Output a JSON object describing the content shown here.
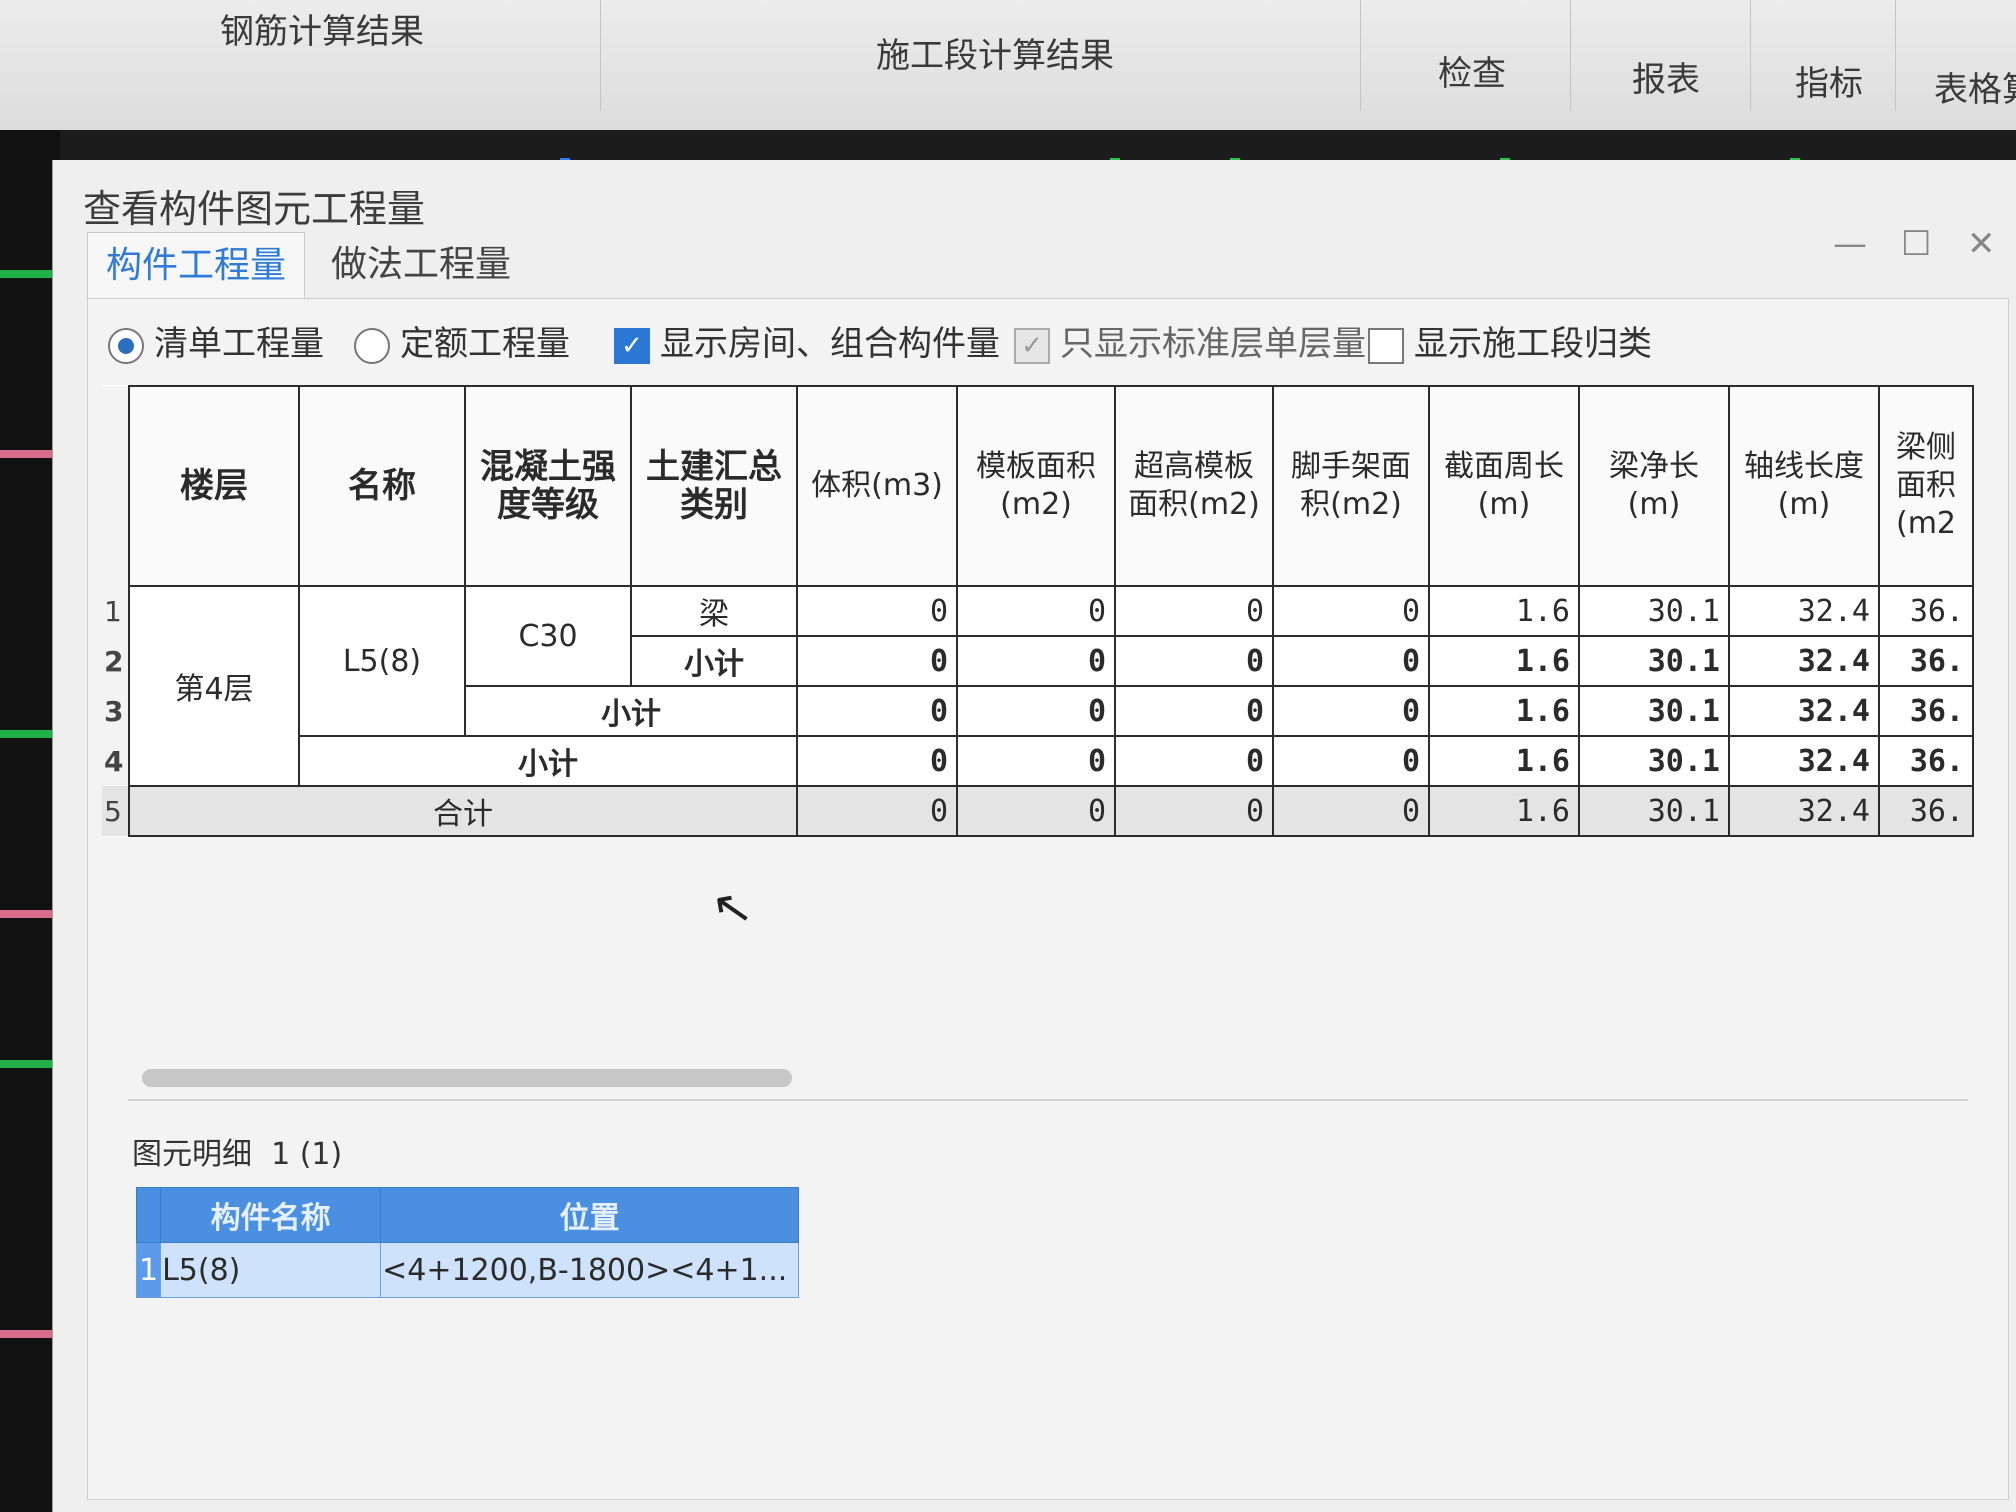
{
  "ribbon": {
    "items": [
      "钢筋计算结果",
      "施工段计算结果",
      "检查",
      "报表",
      "指标",
      "表格算"
    ]
  },
  "dialog": {
    "title": "查看构件图元工程量",
    "controls": {
      "minimize": "—",
      "maximize": "☐",
      "close": "✕"
    },
    "tabs": [
      "构件工程量",
      "做法工程量"
    ],
    "options": {
      "radio_list": "清单工程量",
      "radio_quota": "定额工程量",
      "check_rooms": "显示房间、组合构件量",
      "check_standard": "只显示标准层单层量",
      "check_segments": "显示施工段归类"
    },
    "table": {
      "headers": [
        "楼层",
        "名称",
        "混凝土强度等级",
        "土建汇总类别",
        "体积(m3)",
        "模板面积(m2)",
        "超高模板面积(m2)",
        "脚手架面积(m2)",
        "截面周长(m)",
        "梁净长(m)",
        "轴线长度(m)",
        "梁侧面积(m2"
      ],
      "row_numbers": [
        "1",
        "2",
        "3",
        "4",
        "5"
      ],
      "floor": "第4层",
      "name": "L5(8)",
      "grade": "C30",
      "category": "梁",
      "subtotal": "小计",
      "total": "合计",
      "values": [
        "0",
        "0",
        "0",
        "0",
        "1.6",
        "30.1",
        "32.4",
        "36."
      ]
    },
    "detail": {
      "label": "图元明细",
      "count": "1 (1)",
      "headers": [
        "构件名称",
        "位置"
      ],
      "row_number": "1",
      "name": "L5(8)",
      "position": "<4+1200,B-1800><4+1..."
    }
  }
}
